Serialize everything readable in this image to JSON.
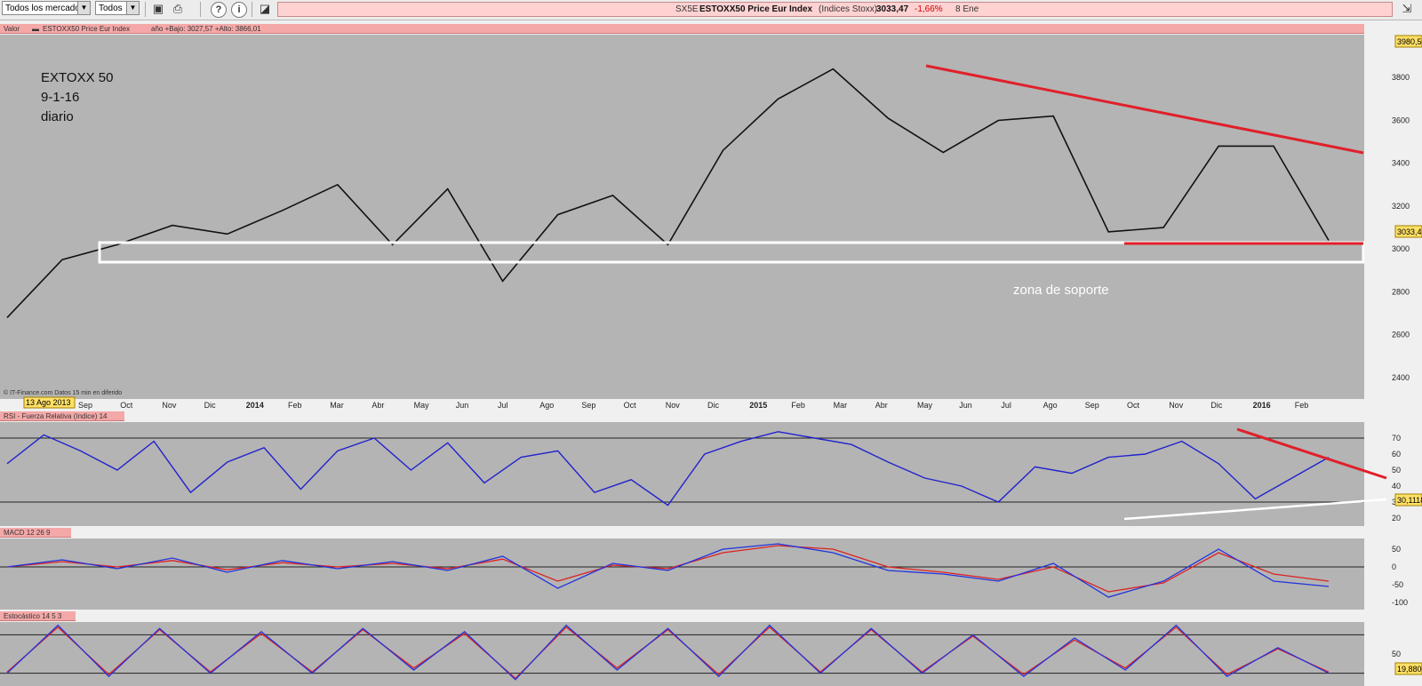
{
  "toolbar": {
    "market_select": "Todos los mercados",
    "filter_select": "Todos",
    "save_icon": "save-icon",
    "print_icon": "print-icon",
    "help_icon": "help-icon",
    "info_icon": "info-icon"
  },
  "title_bar": {
    "code": "SX5E",
    "name": "ESTOXX50 Price Eur Index",
    "exchange": "(Indices Stoxx)",
    "price": "3033,47",
    "change": "-1,66%",
    "date": "8 Ene"
  },
  "price_panel": {
    "header_valor": "Valor",
    "header_series": "ESTOXX50 Price Eur Index",
    "header_range": "año +Bajo: 3027,57 +Alto: 3866,01",
    "annotation": [
      "EXTOXX 50",
      "9-1-16",
      "diario"
    ],
    "support_label": "zona de soporte",
    "source": "© IT-Finance.com   Datos 15 min en diferido",
    "top_value_label": "3980,54",
    "last_value_label": "3033,47",
    "date_flag": "13 Ago 2013"
  },
  "rsi_panel": {
    "header": "RSI - Fuerza Relativa (índice) 14",
    "last_value_label": "30,1118"
  },
  "macd_panel": {
    "header": "MACD 12 26 9"
  },
  "stoch_panel": {
    "header": "Estocástico 14 5 3",
    "last_value_label": "19,8808"
  },
  "chart_data": [
    {
      "type": "line",
      "title": "ESTOXX50 Price Eur Index",
      "x_tick_labels": [
        "Sep",
        "Oct",
        "Nov",
        "Dic",
        "2014",
        "Feb",
        "Mar",
        "Abr",
        "May",
        "Jun",
        "Jul",
        "Ago",
        "Sep",
        "Oct",
        "Nov",
        "Dic",
        "2015",
        "Feb",
        "Mar",
        "Abr",
        "May",
        "Jun",
        "Jul",
        "Ago",
        "Sep",
        "Oct",
        "Nov",
        "Dic",
        "2016",
        "Feb"
      ],
      "y_tick_labels": [
        "3800",
        "3600",
        "3400",
        "3200",
        "3000",
        "2800",
        "2600",
        "2400"
      ],
      "ylim": [
        2300,
        4000
      ],
      "series": [
        {
          "x": [
            "13 Ago 2013",
            "Oct 2013",
            "Dic 2013",
            "Ene 2014",
            "Mar 2014",
            "Abr 2014",
            "Jun 2014",
            "Ago 2014",
            "Sep 2014",
            "Oct 2014",
            "Nov 2014",
            "Dic 2014",
            "Ene 2015",
            "Feb 2015",
            "Mar 2015",
            "Abr 2015",
            "May 2015",
            "Jun 2015",
            "Jul 2015",
            "Ago 2015",
            "Sep 2015",
            "Oct 2015",
            "Nov 2015",
            "Dic 2015",
            "Ene 2016"
          ],
          "values": [
            2680,
            2950,
            3020,
            3110,
            3070,
            3180,
            3300,
            3020,
            3280,
            2850,
            3160,
            3250,
            3020,
            3460,
            3700,
            3840,
            3610,
            3450,
            3600,
            3620,
            3080,
            3100,
            3480,
            3480,
            3040
          ]
        }
      ]
    },
    {
      "type": "line",
      "title": "RSI - Fuerza Relativa (índice) 14",
      "y_tick_labels": [
        "70",
        "60",
        "50",
        "40",
        "30",
        "20"
      ],
      "ylim": [
        15,
        80
      ],
      "guide_lines": [
        70,
        30
      ],
      "series": [
        {
          "values": [
            54,
            72,
            62,
            50,
            68,
            36,
            55,
            64,
            38,
            62,
            70,
            50,
            67,
            42,
            58,
            62,
            36,
            44,
            28,
            60,
            68,
            74,
            70,
            66,
            55,
            45,
            40,
            30,
            52,
            48,
            58,
            60,
            68,
            54,
            32,
            45,
            58
          ]
        }
      ]
    },
    {
      "type": "line",
      "title": "MACD 12 26 9",
      "y_tick_labels": [
        "50",
        "0",
        "-50",
        "-100"
      ],
      "ylim": [
        -120,
        80
      ],
      "series": [
        {
          "values": [
            0,
            20,
            -5,
            25,
            -15,
            18,
            -5,
            15,
            -10,
            30,
            -60,
            10,
            -10,
            50,
            65,
            40,
            -10,
            -20,
            -40,
            10,
            -85,
            -40,
            50,
            -40,
            -55
          ]
        },
        {
          "values": [
            0,
            15,
            0,
            18,
            -8,
            12,
            0,
            10,
            -5,
            22,
            -40,
            5,
            -5,
            40,
            60,
            50,
            0,
            -15,
            -35,
            0,
            -70,
            -45,
            40,
            -20,
            -40
          ]
        }
      ]
    },
    {
      "type": "line",
      "title": "Estocástico 14 5 3",
      "y_tick_labels": [
        "50"
      ],
      "ylim": [
        0,
        100
      ],
      "guide_lines": [
        80,
        20
      ],
      "series": [
        {
          "values": [
            20,
            95,
            15,
            90,
            20,
            85,
            20,
            90,
            25,
            85,
            10,
            95,
            25,
            90,
            15,
            95,
            20,
            90,
            20,
            80,
            15,
            75,
            25,
            95,
            15,
            60,
            20
          ]
        },
        {
          "values": [
            22,
            92,
            18,
            88,
            22,
            82,
            22,
            88,
            28,
            82,
            12,
            92,
            28,
            88,
            18,
            92,
            22,
            88,
            22,
            78,
            18,
            72,
            28,
            92,
            18,
            58,
            22
          ]
        }
      ]
    }
  ],
  "colors": {
    "price": "#111111",
    "rsi": "#2222cc",
    "macd_line": "#2233dd",
    "signal_line": "#dd2222",
    "trendline": "#e0202a",
    "support": "#ffffff",
    "panel_bg": "#b4b4b4"
  }
}
